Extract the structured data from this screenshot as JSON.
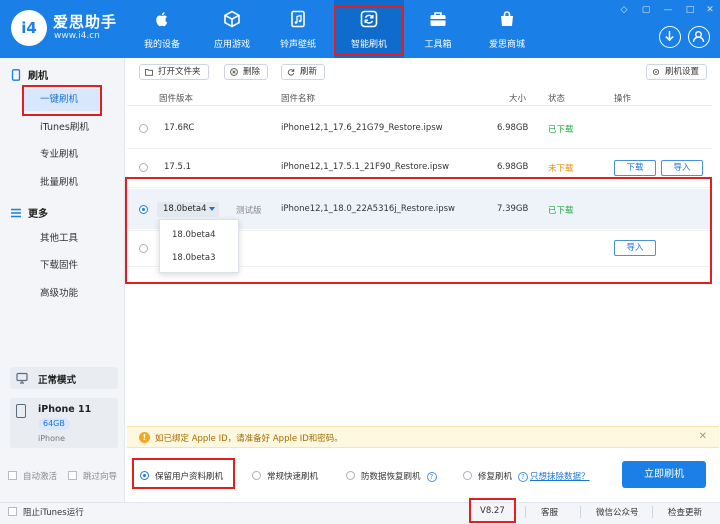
{
  "brand": {
    "logo_text": "i4",
    "name": "爱思助手",
    "url": "www.i4.cn"
  },
  "nav": [
    {
      "label": "我的设备",
      "icon": "apple-icon"
    },
    {
      "label": "应用游戏",
      "icon": "cube-icon"
    },
    {
      "label": "铃声壁纸",
      "icon": "music-file-icon"
    },
    {
      "label": "智能刷机",
      "icon": "refresh-box-icon",
      "active": true
    },
    {
      "label": "工具箱",
      "icon": "toolbox-icon"
    },
    {
      "label": "爱思商城",
      "icon": "shopping-bag-icon"
    }
  ],
  "sidebar": {
    "section_flash": "刷机",
    "items_flash": [
      "一键刷机",
      "iTunes刷机",
      "专业刷机",
      "批量刷机"
    ],
    "section_more": "更多",
    "items_more": [
      "其他工具",
      "下载固件",
      "高级功能"
    ],
    "mode": "正常模式",
    "device": {
      "name": "iPhone 11",
      "capacity": "64GB",
      "type": "iPhone"
    }
  },
  "toolbar": {
    "open_folder": "打开文件夹",
    "delete": "删除",
    "refresh": "刷新",
    "settings": "刷机设置"
  },
  "table": {
    "headers": {
      "version": "固件版本",
      "name": "固件名称",
      "size": "大小",
      "status": "状态",
      "action": "操作"
    },
    "rows": [
      {
        "version": "17.6RC",
        "name": "iPhone12,1_17.6_21G79_Restore.ipsw",
        "size": "6.98GB",
        "status": "已下载",
        "actions": []
      },
      {
        "version": "17.5.1",
        "name": "iPhone12,1_17.5.1_21F90_Restore.ipsw",
        "size": "6.98GB",
        "status": "未下载",
        "actions": [
          "下载",
          "导入"
        ]
      },
      {
        "version": "18.0beta4",
        "tag": "测试版",
        "name": "iPhone12,1_18.0_22A5316j_Restore.ipsw",
        "size": "7.39GB",
        "status": "已下载",
        "actions": []
      },
      {
        "version": "",
        "name": "",
        "size": "",
        "status": "",
        "actions": [
          "导入"
        ]
      }
    ],
    "dropdown_options": [
      "18.0beta4",
      "18.0beta3"
    ]
  },
  "notice": {
    "text": "如已绑定 Apple ID，请准备好 Apple ID和密码。"
  },
  "options": {
    "keep_data": "保留用户资料刷机",
    "quick": "常规快速刷机",
    "anti_recovery": "防数据恢复刷机",
    "repair": "修复刷机",
    "erase_link": "只想抹除数据？",
    "auto_activate": "自动激活",
    "skip_guide": "跳过向导",
    "flash_now": "立即刷机"
  },
  "statusbar": {
    "block_itunes": "阻止iTunes运行",
    "version": "V8.27",
    "support": "客服",
    "wechat": "微信公众号",
    "update": "检查更新"
  },
  "colors": {
    "brand_blue": "#1a7fe6",
    "downloaded_green": "#22a845",
    "not_downloaded_orange": "#f08a00",
    "highlight_red": "#e02020"
  }
}
